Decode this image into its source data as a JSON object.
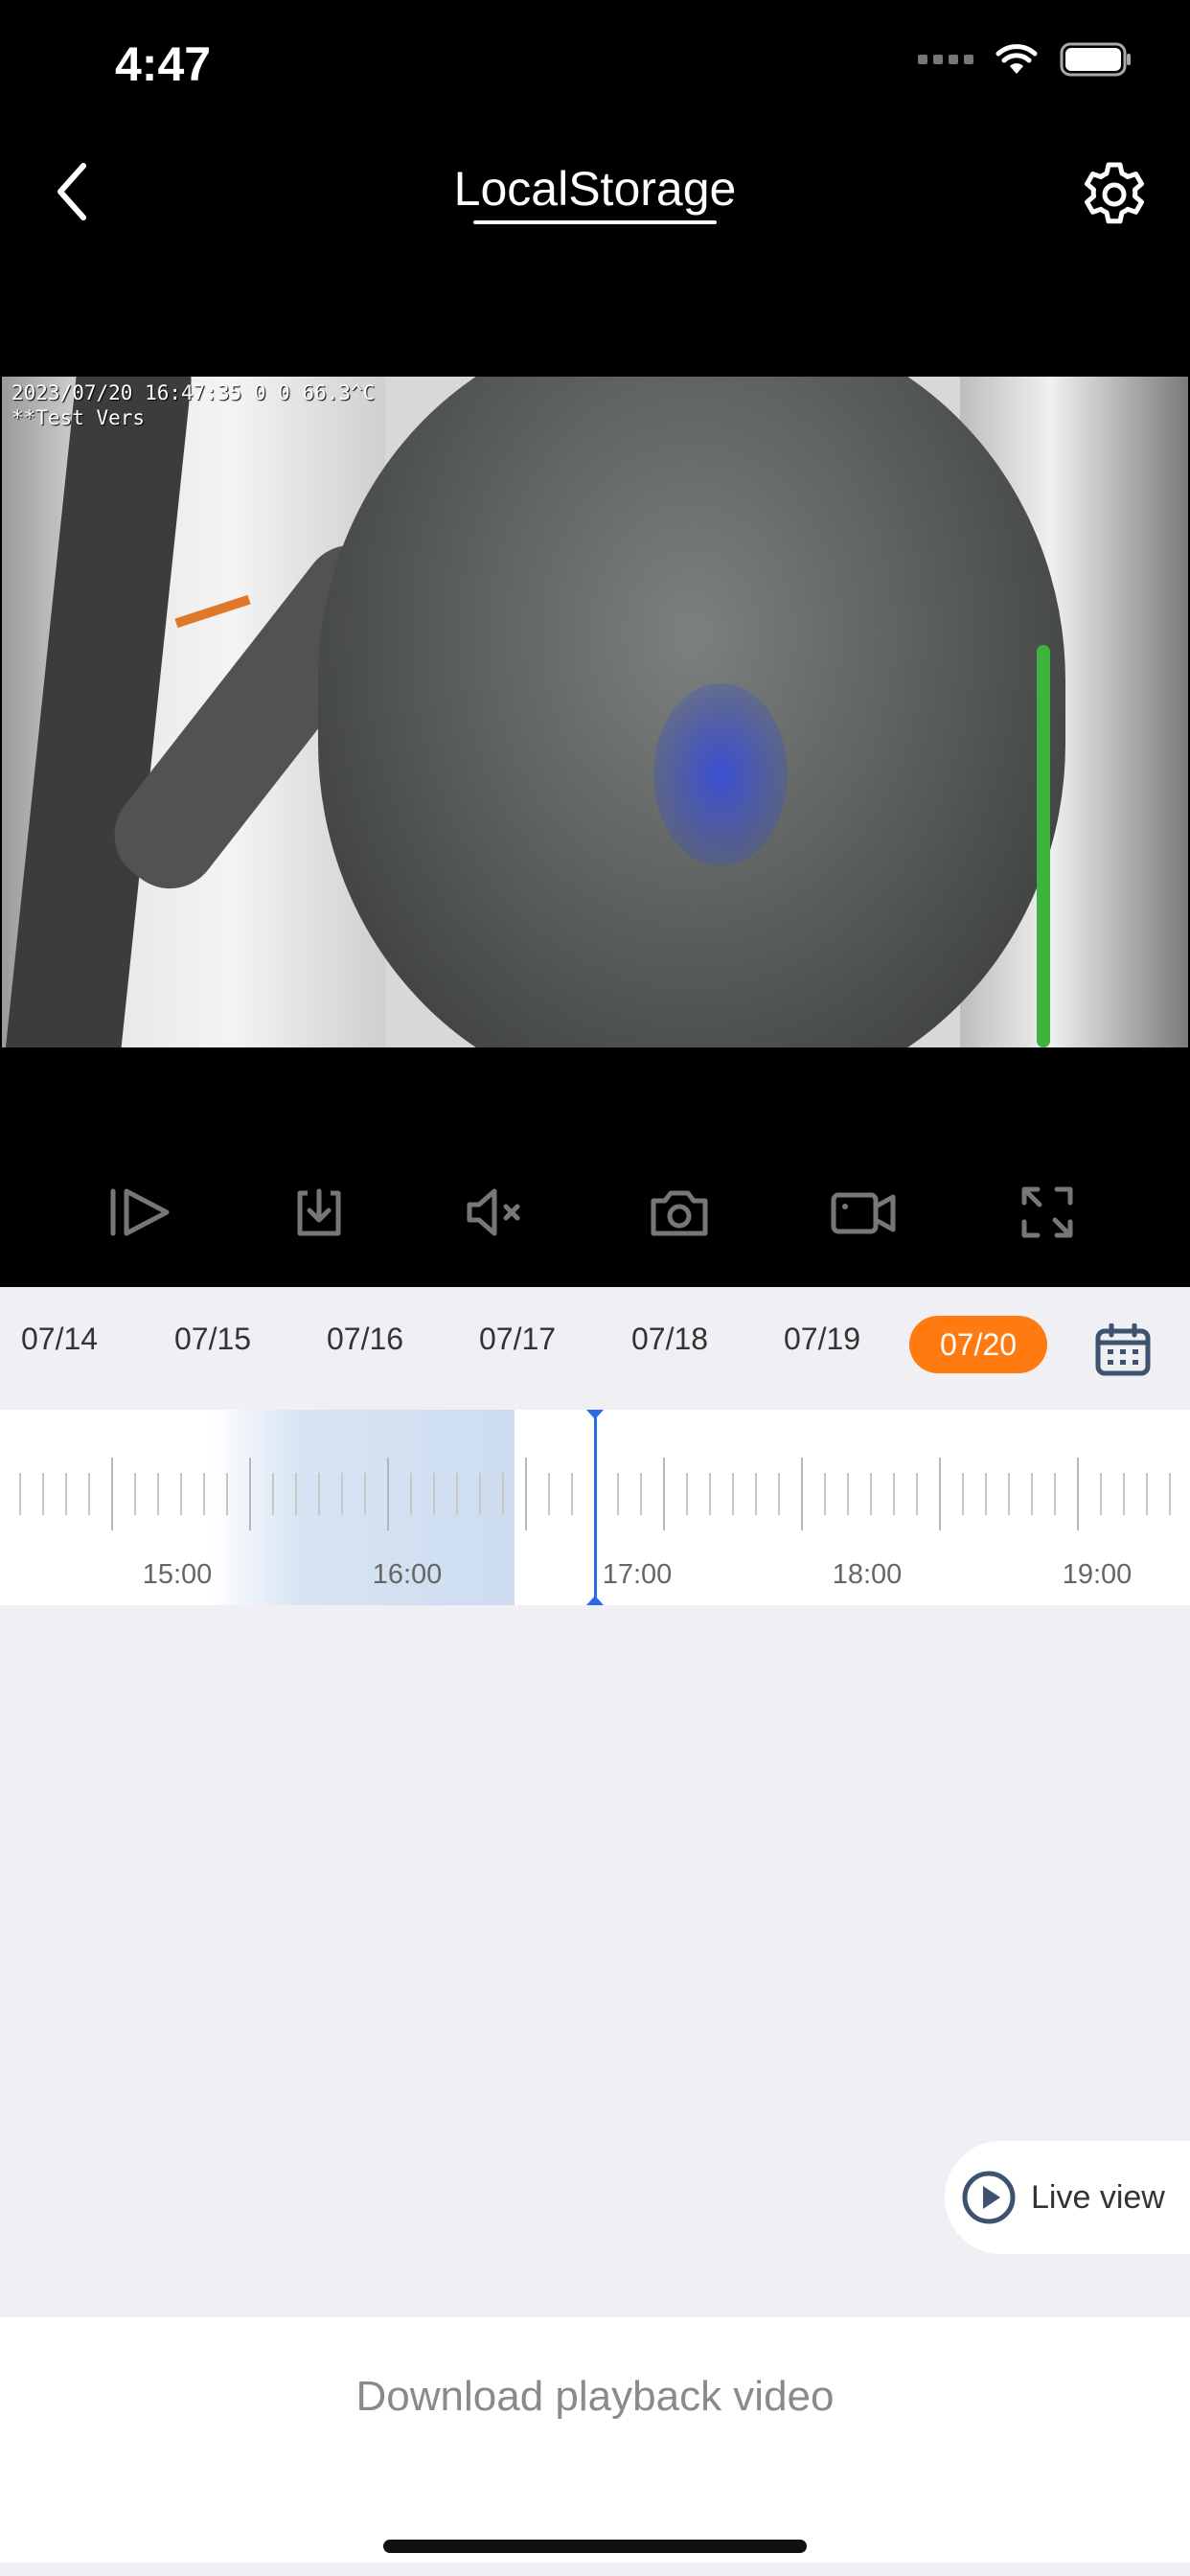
{
  "status_bar": {
    "time": "4:47",
    "icons": [
      "cellular-signal-icon",
      "wifi-icon",
      "battery-icon"
    ]
  },
  "nav": {
    "title": "LocalStorage",
    "back_icon": "chevron-left-icon",
    "settings_icon": "gear-icon"
  },
  "video": {
    "osd_line1": "2023/07/20 16:47:35  0 0 66.3^C",
    "osd_line2": "**Test Vers"
  },
  "controls": [
    {
      "name": "play-icon"
    },
    {
      "name": "download-icon"
    },
    {
      "name": "mute-icon"
    },
    {
      "name": "camera-icon"
    },
    {
      "name": "record-video-icon"
    },
    {
      "name": "fullscreen-icon"
    }
  ],
  "dates": {
    "items": [
      "07/14",
      "07/15",
      "07/16",
      "07/17",
      "07/18",
      "07/19"
    ],
    "selected": "07/20",
    "calendar_icon": "calendar-icon"
  },
  "timeline": {
    "labels": [
      "15:00",
      "16:00",
      "17:00",
      "18:00",
      "19:00"
    ]
  },
  "live_view": {
    "label": "Live view",
    "icon": "play-circle-icon"
  },
  "bottom": {
    "download_label": "Download playback video"
  },
  "colors": {
    "accent": "#ff7a10",
    "cursor": "#2a6be6"
  }
}
